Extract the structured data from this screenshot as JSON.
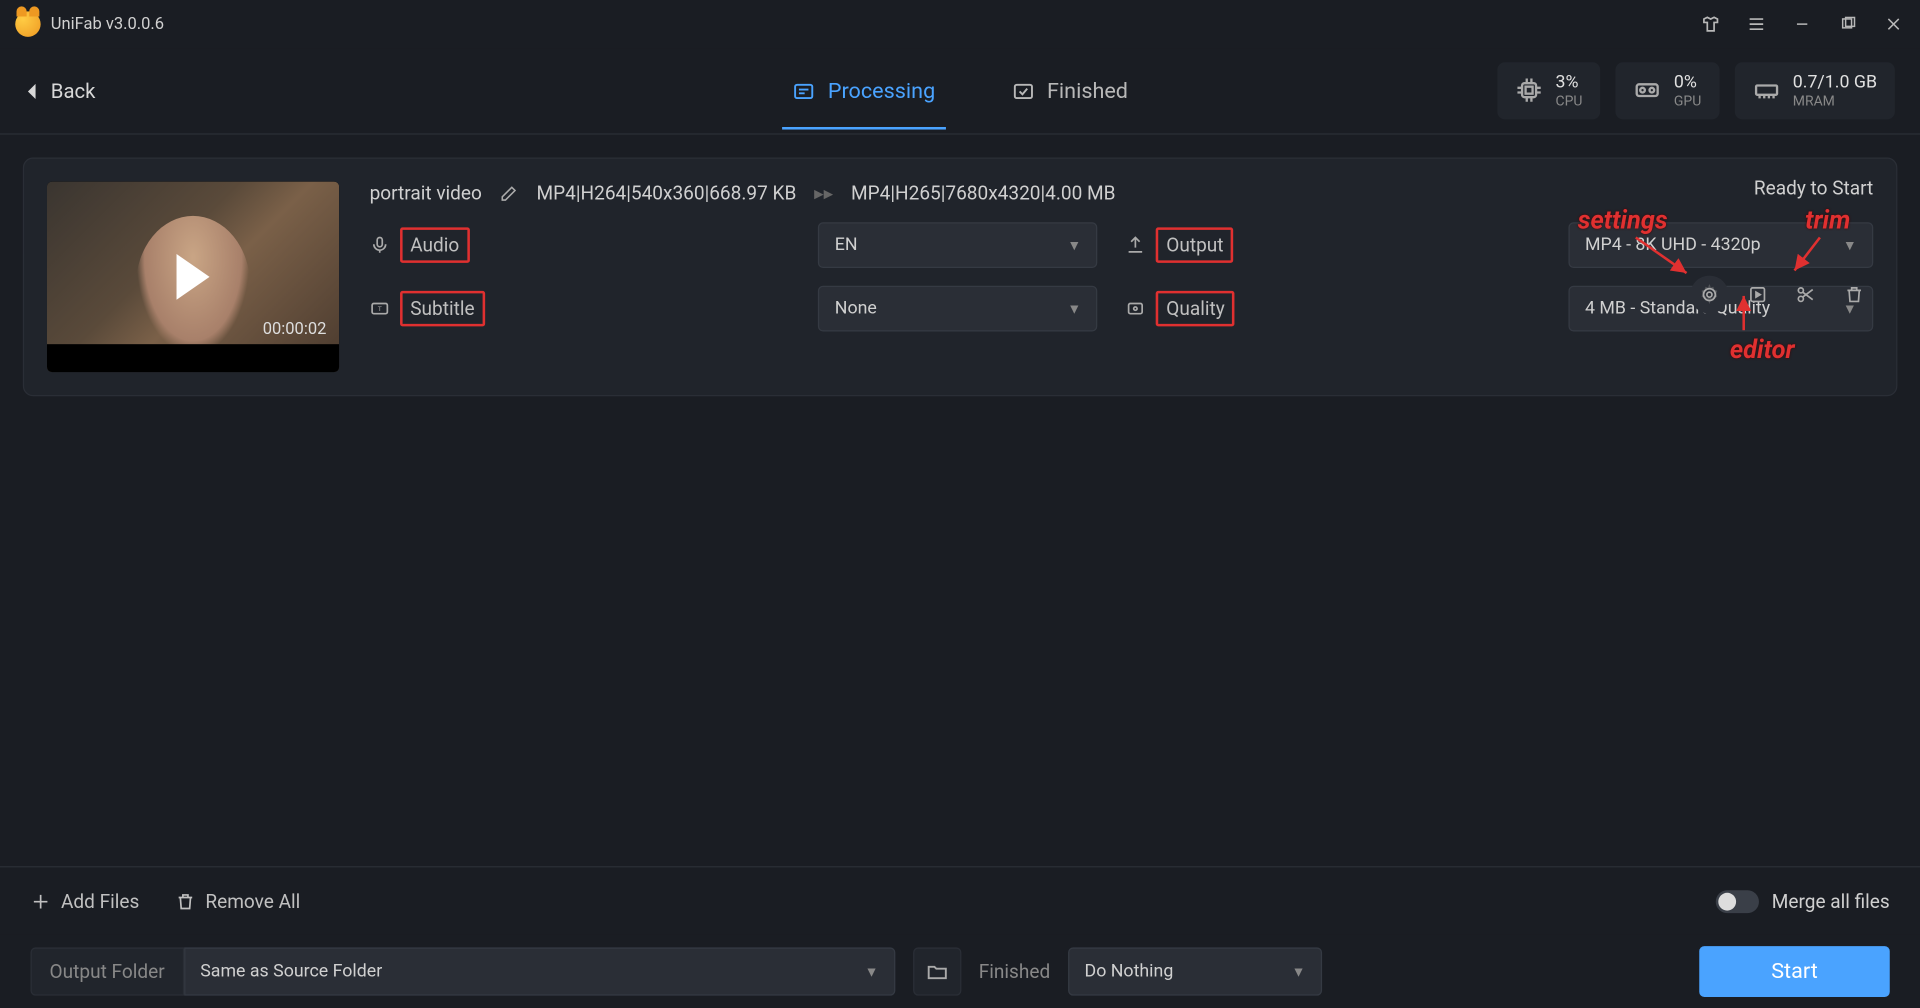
{
  "app": {
    "title": "UniFab v3.0.0.6"
  },
  "header": {
    "back": "Back",
    "tabs": {
      "processing": "Processing",
      "finished": "Finished"
    },
    "stats": {
      "cpu_val": "3%",
      "cpu_lbl": "CPU",
      "gpu_val": "0%",
      "gpu_lbl": "GPU",
      "ram_val": "0.7/1.0 GB",
      "ram_lbl": "MRAM"
    }
  },
  "item": {
    "name": "portrait video",
    "src_info": "MP4|H264|540x360|668.97 KB",
    "dst_info": "MP4|H265|7680x4320|4.00 MB",
    "duration": "00:00:02",
    "status": "Ready to Start",
    "labels": {
      "audio": "Audio",
      "subtitle": "Subtitle",
      "output": "Output",
      "quality": "Quality"
    },
    "values": {
      "audio": "EN",
      "subtitle": "None",
      "output": "MP4 - 8K UHD - 4320p",
      "quality": "4 MB - Standard Quality"
    }
  },
  "annotations": {
    "settings": "settings",
    "trim": "trim",
    "editor": "editor"
  },
  "bottom": {
    "add_files": "Add Files",
    "remove_all": "Remove All",
    "merge": "Merge all files"
  },
  "output": {
    "folder_label": "Output Folder",
    "folder_value": "Same as Source Folder",
    "finished_label": "Finished",
    "finished_value": "Do Nothing",
    "start": "Start"
  }
}
